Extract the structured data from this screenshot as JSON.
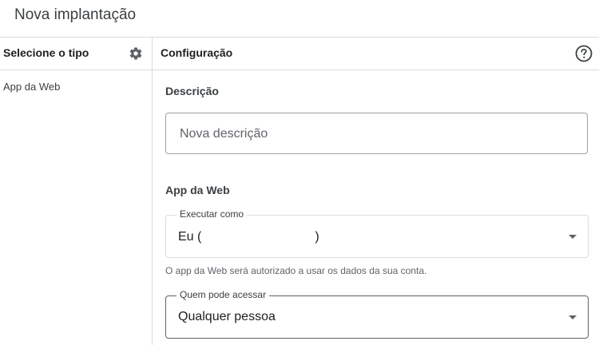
{
  "dialog": {
    "title": "Nova implantação"
  },
  "left_panel": {
    "title": "Selecione o tipo",
    "settings_icon": "gear-icon",
    "items": [
      {
        "label": "App da Web"
      }
    ]
  },
  "right_panel": {
    "title": "Configuração",
    "help_icon": "help-circle-icon",
    "description_label": "Descrição",
    "description_placeholder": "Nova descrição",
    "webapp_label": "App da Web",
    "execute_as": {
      "label": "Executar como",
      "value_prefix": "Eu (",
      "value_suffix": ")"
    },
    "execute_hint": "O app da Web será autorizado a usar os dados da sua conta.",
    "access": {
      "label": "Quem pode acessar",
      "value": "Qualquer pessoa"
    }
  }
}
